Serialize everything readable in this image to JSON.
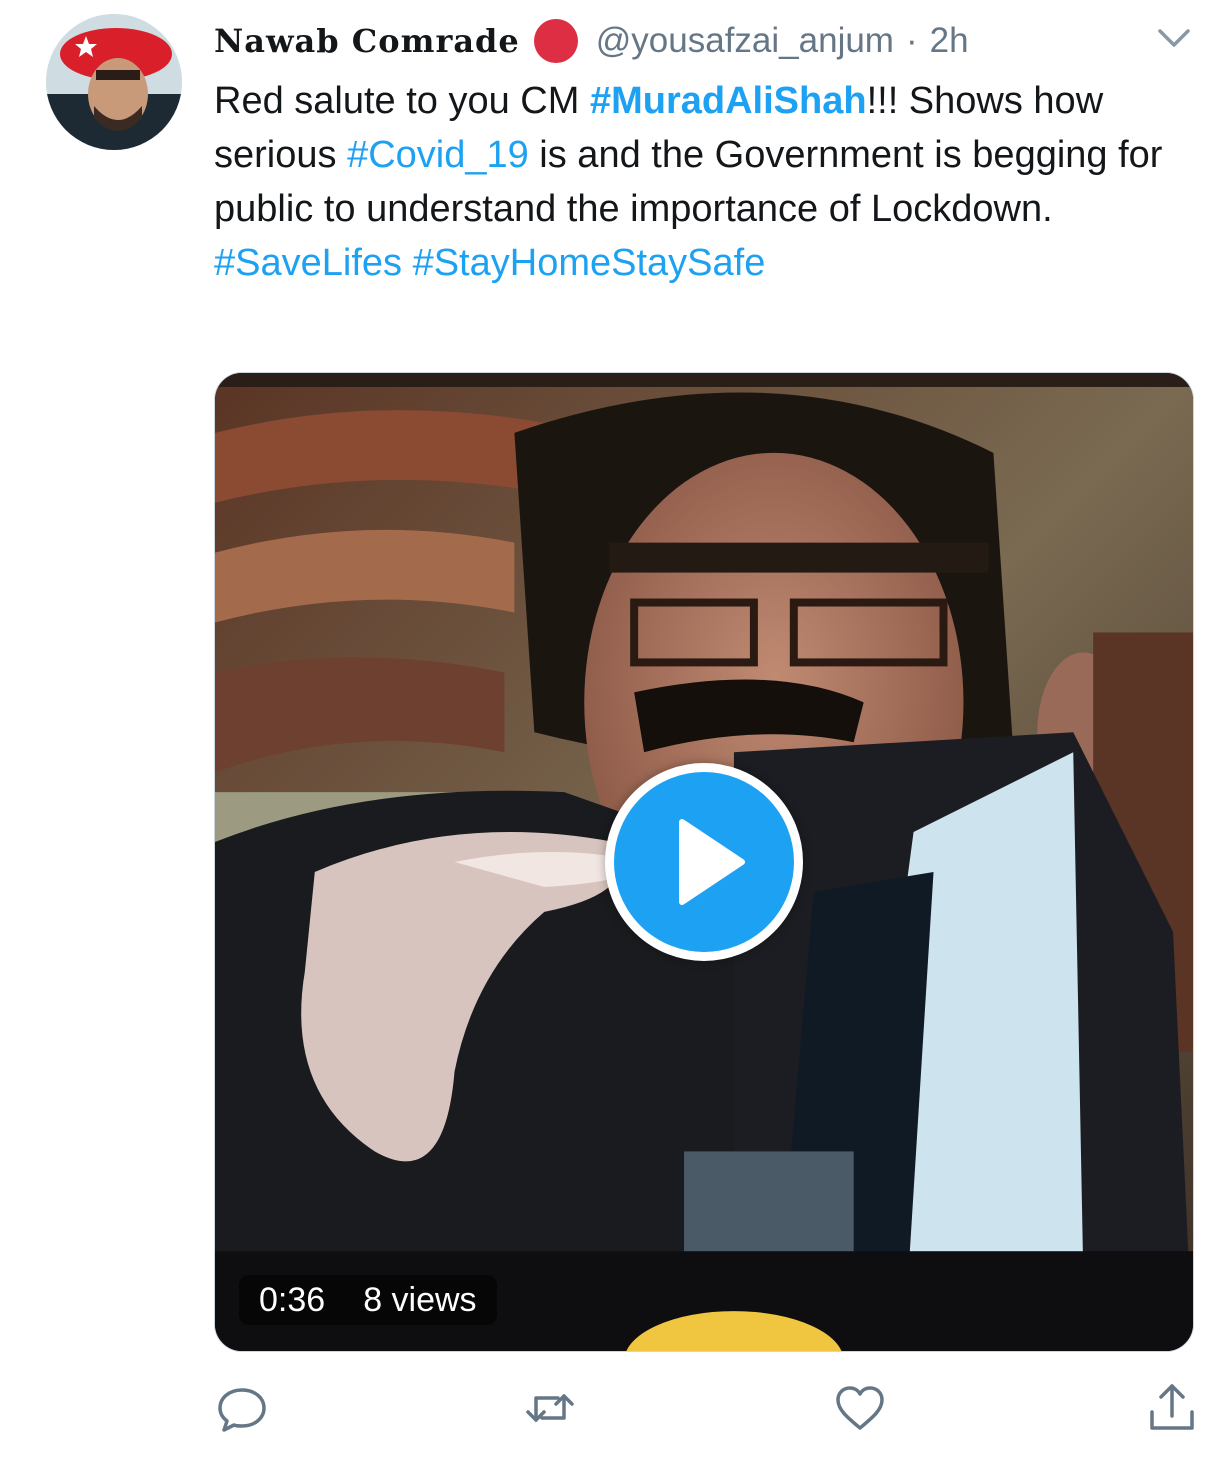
{
  "tweet": {
    "display_name": "Nawab Comrade",
    "handle": "@yousafzai_anjum",
    "separator": "·",
    "time": "2h",
    "text": {
      "p1_a": "Red salute to you CM ",
      "p1_tag1": "#MuradAliShah",
      "p1_b": "!!! Shows how serious ",
      "p1_tag2": "#Covid_19",
      "p1_c": " is and the Government is begging for public to understand the importance of Lockdown.",
      "p2_tag1": "#SaveLifes",
      "p2_space": " ",
      "p2_tag2": "#StayHomeStaySafe"
    }
  },
  "video": {
    "duration": "0:36",
    "views": "8 views"
  },
  "icons": {
    "more": "chevron-down-icon",
    "reply": "reply-icon",
    "retweet": "retweet-icon",
    "like": "heart-icon",
    "share": "share-icon",
    "play": "play-icon"
  },
  "colors": {
    "link": "#1da1f2",
    "secondary_text": "#657786",
    "action_icon": "#657786"
  }
}
